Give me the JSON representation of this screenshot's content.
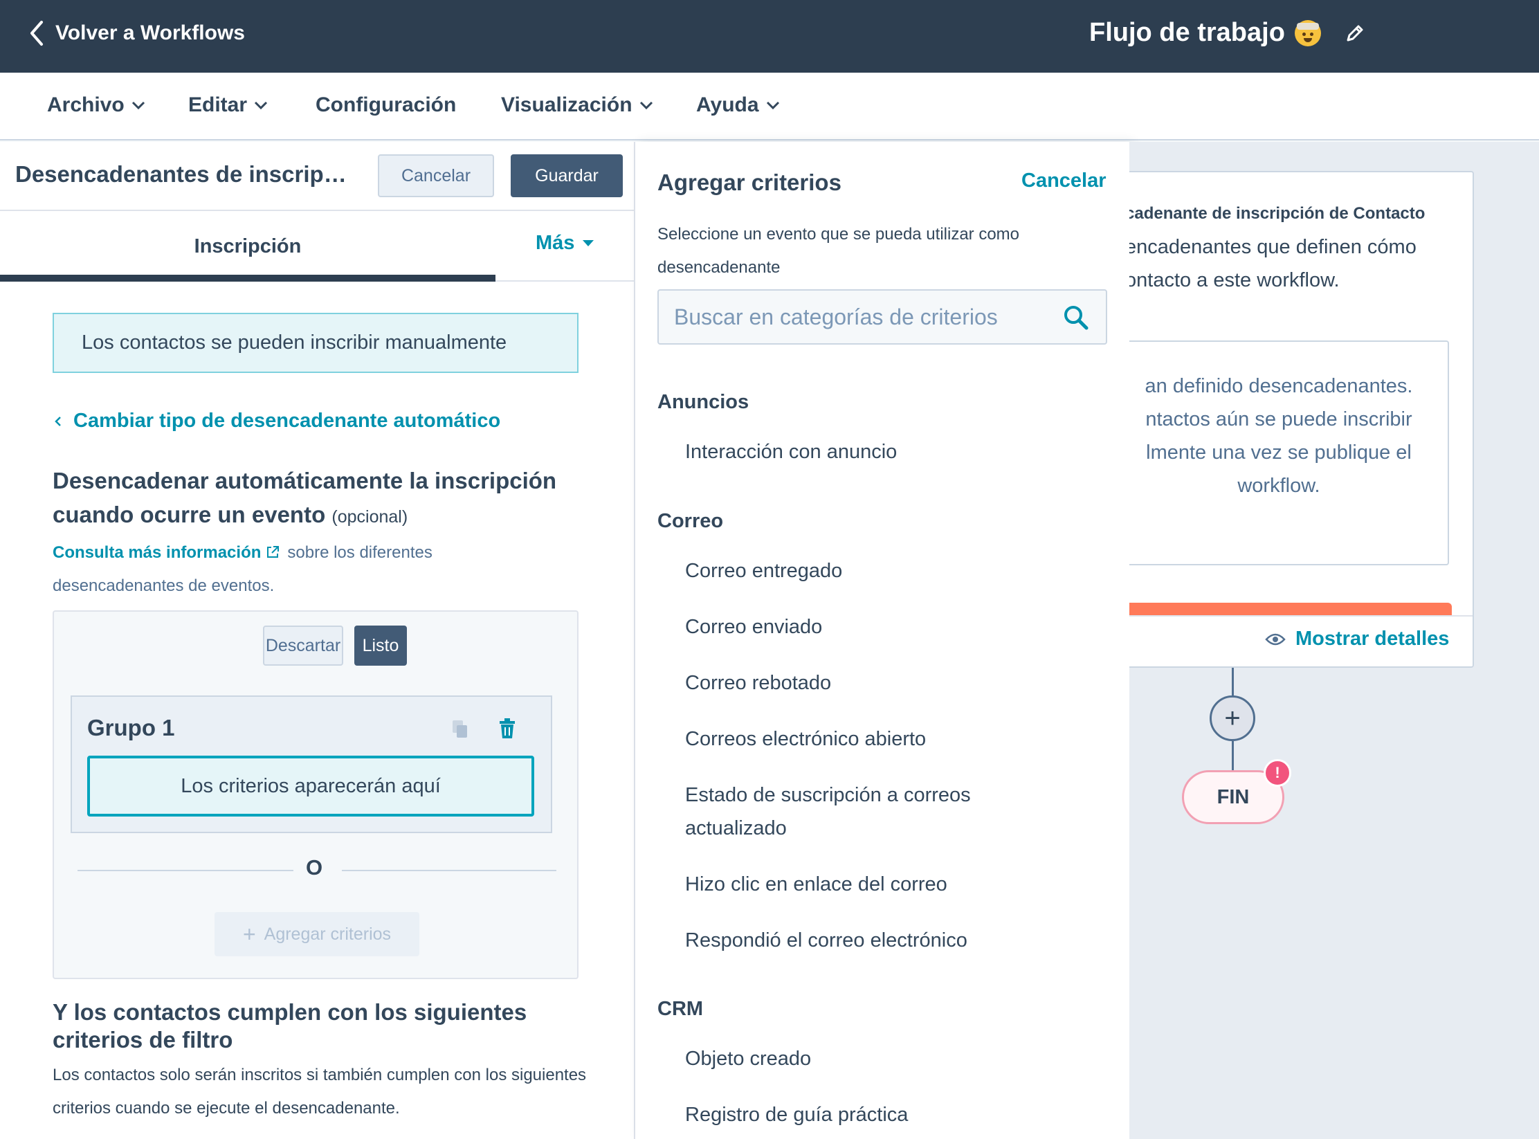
{
  "topbar": {
    "back_label": "Volver a Workflows",
    "workflow_title": "Flujo de trabajo"
  },
  "menu": [
    "Archivo",
    "Editar",
    "Configuración",
    "Visualización",
    "Ayuda"
  ],
  "left_panel": {
    "title": "Desencadenantes de inscripc...",
    "cancel_label": "Cancelar",
    "save_label": "Guardar",
    "tab_enrollment": "Inscripción",
    "tab_more": "Más",
    "manual_note": "Los contactos se pueden inscribir manualmente",
    "change_trigger_link": "Cambiar tipo de desencadenante automático",
    "event_heading": "Desencadenar automáticamente la inscripción cuando ocurre un evento",
    "event_optional": "(opcional)",
    "more_info_link": "Consulta más información",
    "more_info_rest": "sobre los diferentes desencadenantes de eventos.",
    "discard_label": "Descartar",
    "done_label": "Listo",
    "group_title": "Grupo 1",
    "criteria_placeholder": "Los criterios aparecerán aquí",
    "or_label": "O",
    "add_criteria_label": "Agregar criterios",
    "filter_heading": "Y los contactos cumplen con los siguientes criterios de filtro",
    "filter_desc": "Los contactos solo serán inscritos si también cumplen con los siguientes criterios cuando se ejecute el desencadenante."
  },
  "criteria_panel": {
    "title": "Agregar criterios",
    "cancel_label": "Cancelar",
    "description": "Seleccione un evento que se pueda utilizar como desencadenante",
    "search_placeholder": "Buscar en categorías de criterios",
    "categories": [
      {
        "name": "Anuncios",
        "items": [
          "Interacción con anuncio"
        ]
      },
      {
        "name": "Correo",
        "items": [
          "Correo entregado",
          "Correo enviado",
          "Correo rebotado",
          "Correos electrónico abierto",
          "Estado de suscripción a correos actualizado",
          "Hizo clic en enlace del correo",
          "Respondió el correo electrónico"
        ]
      },
      {
        "name": "CRM",
        "items": [
          "Objeto creado",
          "Registro de guía práctica"
        ]
      }
    ]
  },
  "canvas": {
    "trigger_card_title": "cadenante de inscripción de Contacto",
    "trigger_card_desc": "encadenantes que definen cómo\nontacto a este workflow.",
    "inner_text": "an definido desencadenantes.\nntactos aún se puede inscribir\nlmente una vez se publique el\nworkflow.",
    "show_details_label": "Mostrar detalles",
    "end_label": "FIN",
    "end_badge": "!"
  },
  "colors": {
    "topbar": "#2d3e50",
    "accent_link": "#0091ae",
    "primary_button": "#425b76",
    "orange_bar": "#ff7a59",
    "alert_badge": "#f2547d"
  }
}
